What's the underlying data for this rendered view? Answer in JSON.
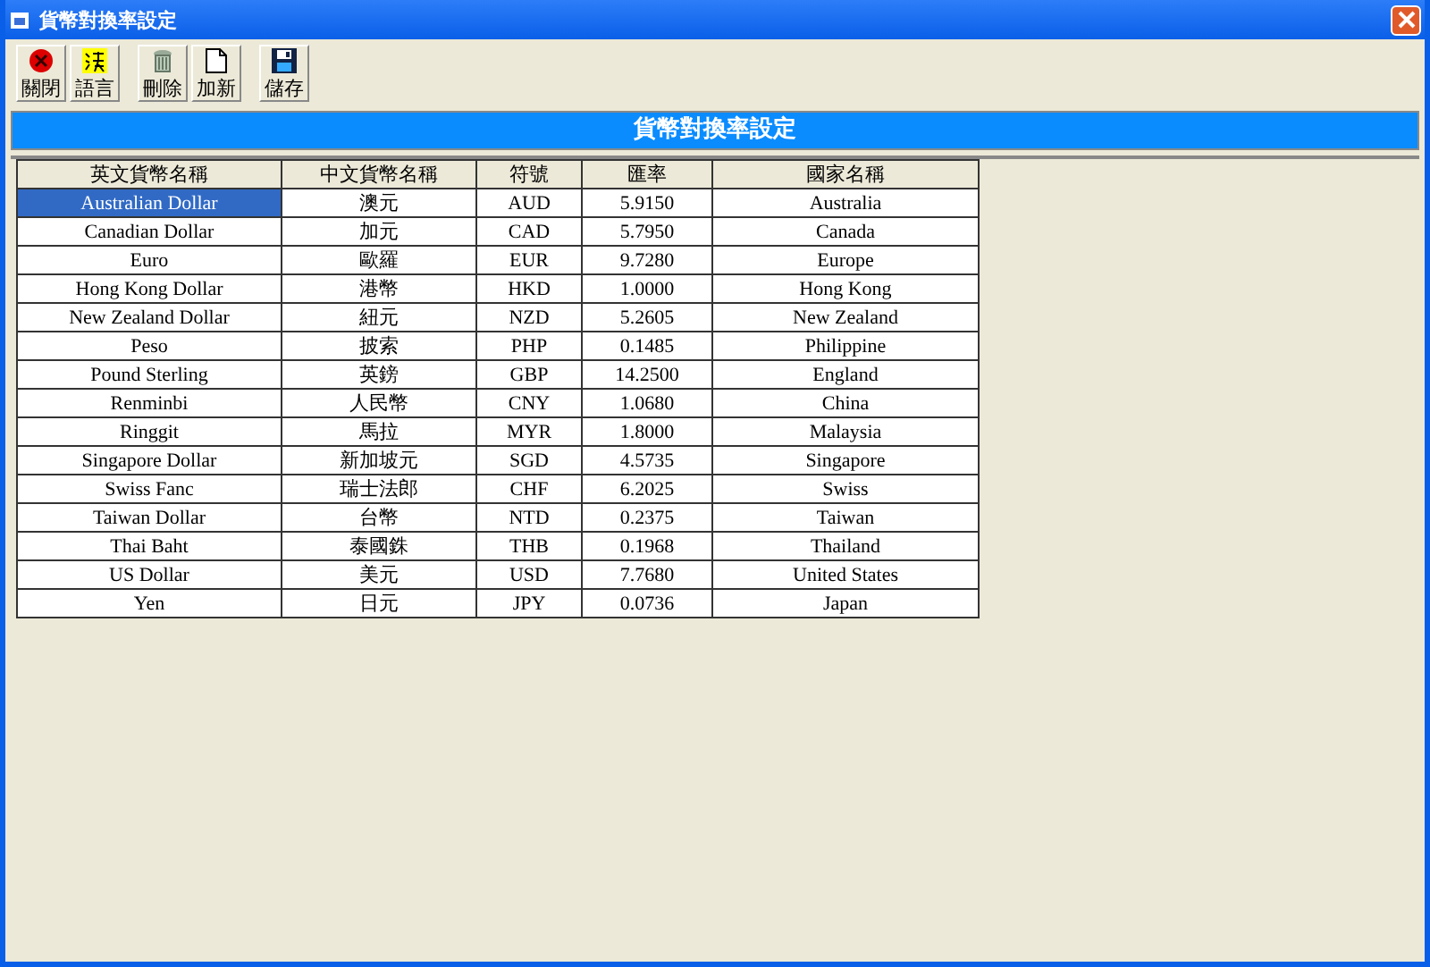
{
  "window": {
    "title": "貨幣對換率設定"
  },
  "toolbar_groups": [
    {
      "buttons": [
        {
          "label": "關閉",
          "kind": "close"
        },
        {
          "label": "語言",
          "kind": "language"
        }
      ]
    },
    {
      "buttons": [
        {
          "label": "刪除",
          "kind": "delete"
        },
        {
          "label": "加新",
          "kind": "new"
        }
      ]
    },
    {
      "buttons": [
        {
          "label": "儲存",
          "kind": "save"
        }
      ]
    }
  ],
  "banner": "貨幣對換率設定",
  "table": {
    "columns": [
      "英文貨幣名稱",
      "中文貨幣名稱",
      "符號",
      "匯率",
      "國家名稱"
    ],
    "rows": [
      {
        "cells": [
          "Australian Dollar",
          "澳元",
          "AUD",
          "5.9150",
          "Australia"
        ],
        "selected": true
      },
      {
        "cells": [
          "Canadian Dollar",
          "加元",
          "CAD",
          "5.7950",
          "Canada"
        ],
        "selected": false
      },
      {
        "cells": [
          "Euro",
          "歐羅",
          "EUR",
          "9.7280",
          "Europe"
        ],
        "selected": false
      },
      {
        "cells": [
          "Hong Kong Dollar",
          "港幣",
          "HKD",
          "1.0000",
          "Hong Kong"
        ],
        "selected": false
      },
      {
        "cells": [
          "New Zealand Dollar",
          "紐元",
          "NZD",
          "5.2605",
          "New Zealand"
        ],
        "selected": false
      },
      {
        "cells": [
          "Peso",
          "披索",
          "PHP",
          "0.1485",
          "Philippine"
        ],
        "selected": false
      },
      {
        "cells": [
          "Pound Sterling",
          "英鎊",
          "GBP",
          "14.2500",
          "England"
        ],
        "selected": false
      },
      {
        "cells": [
          "Renminbi",
          "人民幣",
          "CNY",
          "1.0680",
          "China"
        ],
        "selected": false
      },
      {
        "cells": [
          "Ringgit",
          "馬拉",
          "MYR",
          "1.8000",
          "Malaysia"
        ],
        "selected": false
      },
      {
        "cells": [
          "Singapore Dollar",
          "新加坡元",
          "SGD",
          "4.5735",
          "Singapore"
        ],
        "selected": false
      },
      {
        "cells": [
          "Swiss Fanc",
          "瑞士法郎",
          "CHF",
          "6.2025",
          "Swiss"
        ],
        "selected": false
      },
      {
        "cells": [
          "Taiwan Dollar",
          "台幣",
          "NTD",
          "0.2375",
          "Taiwan"
        ],
        "selected": false
      },
      {
        "cells": [
          "Thai Baht",
          "泰國銖",
          "THB",
          "0.1968",
          "Thailand"
        ],
        "selected": false
      },
      {
        "cells": [
          "US Dollar",
          "美元",
          "USD",
          "7.7680",
          "United States"
        ],
        "selected": false
      },
      {
        "cells": [
          "Yen",
          "日元",
          "JPY",
          "0.0736",
          "Japan"
        ],
        "selected": false
      }
    ]
  }
}
